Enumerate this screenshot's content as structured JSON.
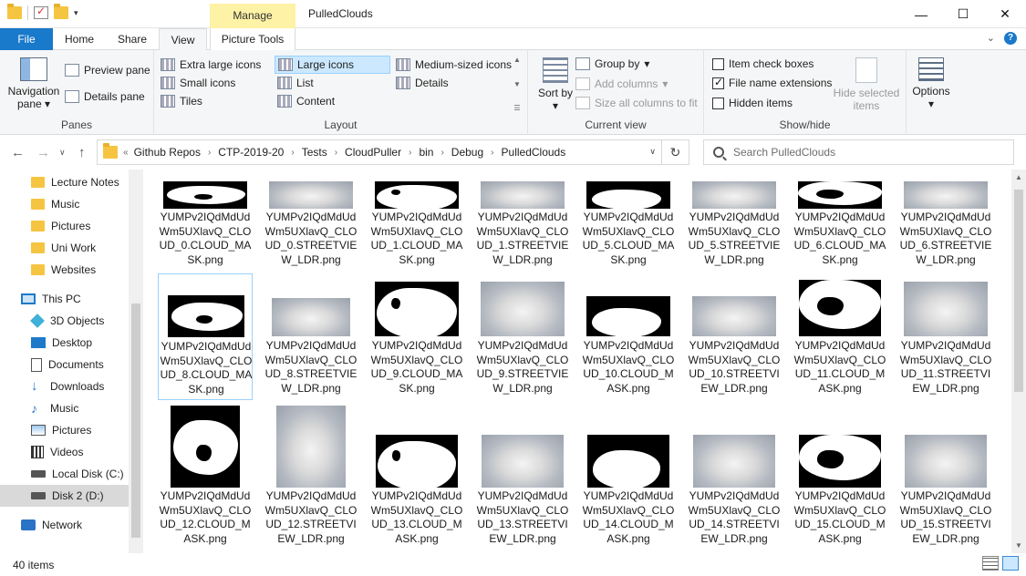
{
  "window": {
    "title": "PulledClouds",
    "manage_label": "Manage",
    "picture_tools_label": "Picture Tools",
    "minimize_glyph": "—",
    "maximize_glyph": "☐",
    "close_glyph": "✕"
  },
  "ribbon_tabs": [
    "File",
    "Home",
    "Share",
    "View"
  ],
  "ribbon": {
    "panes": {
      "navigation_pane": "Navigation pane",
      "preview_pane": "Preview pane",
      "details_pane": "Details pane",
      "group_label": "Panes"
    },
    "layout": {
      "items": [
        {
          "label": "Extra large icons",
          "selected": false
        },
        {
          "label": "Large icons",
          "selected": true
        },
        {
          "label": "Medium-sized icons",
          "selected": false
        },
        {
          "label": "Small icons",
          "selected": false
        },
        {
          "label": "List",
          "selected": false
        },
        {
          "label": "Details",
          "selected": false
        },
        {
          "label": "Tiles",
          "selected": false
        },
        {
          "label": "Content",
          "selected": false
        }
      ],
      "group_label": "Layout"
    },
    "current_view": {
      "sort_by": "Sort by",
      "group_by": "Group by",
      "add_columns": "Add columns",
      "size_all_columns": "Size all columns to fit",
      "group_label": "Current view"
    },
    "show_hide": {
      "item_check_boxes": {
        "label": "Item check boxes",
        "checked": false
      },
      "file_name_extensions": {
        "label": "File name extensions",
        "checked": true
      },
      "hidden_items": {
        "label": "Hidden items",
        "checked": false
      },
      "hide_selected": "Hide selected items",
      "group_label": "Show/hide"
    },
    "options": "Options"
  },
  "address": {
    "breadcrumbs": [
      "Github Repos",
      "CTP-2019-20",
      "Tests",
      "CloudPuller",
      "bin",
      "Debug",
      "PulledClouds"
    ],
    "search_placeholder": "Search PulledClouds"
  },
  "nav_pane": {
    "items": [
      {
        "label": "Lecture Notes",
        "icon": "folder-icon"
      },
      {
        "label": "Music",
        "icon": "folder-icon"
      },
      {
        "label": "Pictures",
        "icon": "folder-icon"
      },
      {
        "label": "Uni Work",
        "icon": "folder-icon"
      },
      {
        "label": "Websites",
        "icon": "folder-icon"
      },
      {
        "label": "This PC",
        "icon": "computer-icon"
      },
      {
        "label": "3D Objects",
        "icon": "3d-objects-icon"
      },
      {
        "label": "Desktop",
        "icon": "desktop-icon"
      },
      {
        "label": "Documents",
        "icon": "documents-icon"
      },
      {
        "label": "Downloads",
        "icon": "downloads-icon"
      },
      {
        "label": "Music",
        "icon": "music-icon"
      },
      {
        "label": "Pictures",
        "icon": "pictures-icon"
      },
      {
        "label": "Videos",
        "icon": "videos-icon"
      },
      {
        "label": "Local Disk (C:)",
        "icon": "disk-icon"
      },
      {
        "label": "Disk 2 (D:)",
        "icon": "disk-icon",
        "selected": true
      },
      {
        "label": "Network",
        "icon": "network-icon"
      }
    ]
  },
  "files": [
    {
      "name": "YUMPv2IQdMdUdWm5UXlavQ_CLOUD_0.CLOUD_MASK.png",
      "kind": "mask"
    },
    {
      "name": "YUMPv2IQdMdUdWm5UXlavQ_CLOUD_0.STREETVIEW_LDR.png",
      "kind": "sky"
    },
    {
      "name": "YUMPv2IQdMdUdWm5UXlavQ_CLOUD_1.CLOUD_MASK.png",
      "kind": "mask"
    },
    {
      "name": "YUMPv2IQdMdUdWm5UXlavQ_CLOUD_1.STREETVIEW_LDR.png",
      "kind": "sky"
    },
    {
      "name": "YUMPv2IQdMdUdWm5UXlavQ_CLOUD_5.CLOUD_MASK.png",
      "kind": "mask"
    },
    {
      "name": "YUMPv2IQdMdUdWm5UXlavQ_CLOUD_5.STREETVIEW_LDR.png",
      "kind": "sky"
    },
    {
      "name": "YUMPv2IQdMdUdWm5UXlavQ_CLOUD_6.CLOUD_MASK.png",
      "kind": "mask"
    },
    {
      "name": "YUMPv2IQdMdUdWm5UXlavQ_CLOUD_6.STREETVIEW_LDR.png",
      "kind": "sky"
    },
    {
      "name": "YUMPv2IQdMdUdWm5UXlavQ_CLOUD_8.CLOUD_MASK.png",
      "kind": "mask",
      "focused": true
    },
    {
      "name": "YUMPv2IQdMdUdWm5UXlavQ_CLOUD_8.STREETVIEW_LDR.png",
      "kind": "sky"
    },
    {
      "name": "YUMPv2IQdMdUdWm5UXlavQ_CLOUD_9.CLOUD_MASK.png",
      "kind": "mask"
    },
    {
      "name": "YUMPv2IQdMdUdWm5UXlavQ_CLOUD_9.STREETVIEW_LDR.png",
      "kind": "sky"
    },
    {
      "name": "YUMPv2IQdMdUdWm5UXlavQ_CLOUD_10.CLOUD_MASK.png",
      "kind": "mask"
    },
    {
      "name": "YUMPv2IQdMdUdWm5UXlavQ_CLOUD_10.STREETVIEW_LDR.png",
      "kind": "sky"
    },
    {
      "name": "YUMPv2IQdMdUdWm5UXlavQ_CLOUD_11.CLOUD_MASK.png",
      "kind": "mask"
    },
    {
      "name": "YUMPv2IQdMdUdWm5UXlavQ_CLOUD_11.STREETVIEW_LDR.png",
      "kind": "sky"
    },
    {
      "name": "YUMPv2IQdMdUdWm5UXlavQ_CLOUD_12.CLOUD_MASK.png",
      "kind": "mask"
    },
    {
      "name": "YUMPv2IQdMdUdWm5UXlavQ_CLOUD_12.STREETVIEW_LDR.png",
      "kind": "sky"
    },
    {
      "name": "YUMPv2IQdMdUdWm5UXlavQ_CLOUD_13.CLOUD_MASK.png",
      "kind": "mask"
    },
    {
      "name": "YUMPv2IQdMdUdWm5UXlavQ_CLOUD_13.STREETVIEW_LDR.png",
      "kind": "sky"
    },
    {
      "name": "YUMPv2IQdMdUdWm5UXlavQ_CLOUD_14.CLOUD_MASK.png",
      "kind": "mask"
    },
    {
      "name": "YUMPv2IQdMdUdWm5UXlavQ_CLOUD_14.STREETVIEW_LDR.png",
      "kind": "sky"
    },
    {
      "name": "YUMPv2IQdMdUdWm5UXlavQ_CLOUD_15.CLOUD_MASK.png",
      "kind": "mask"
    },
    {
      "name": "YUMPv2IQdMdUdWm5UXlavQ_CLOUD_15.STREETVIEW_LDR.png",
      "kind": "sky"
    }
  ],
  "status": {
    "item_count": "40 items"
  },
  "colors": {
    "accent": "#1979ca",
    "manage_tab": "#fdf2a5",
    "selection": "#cce8ff"
  }
}
